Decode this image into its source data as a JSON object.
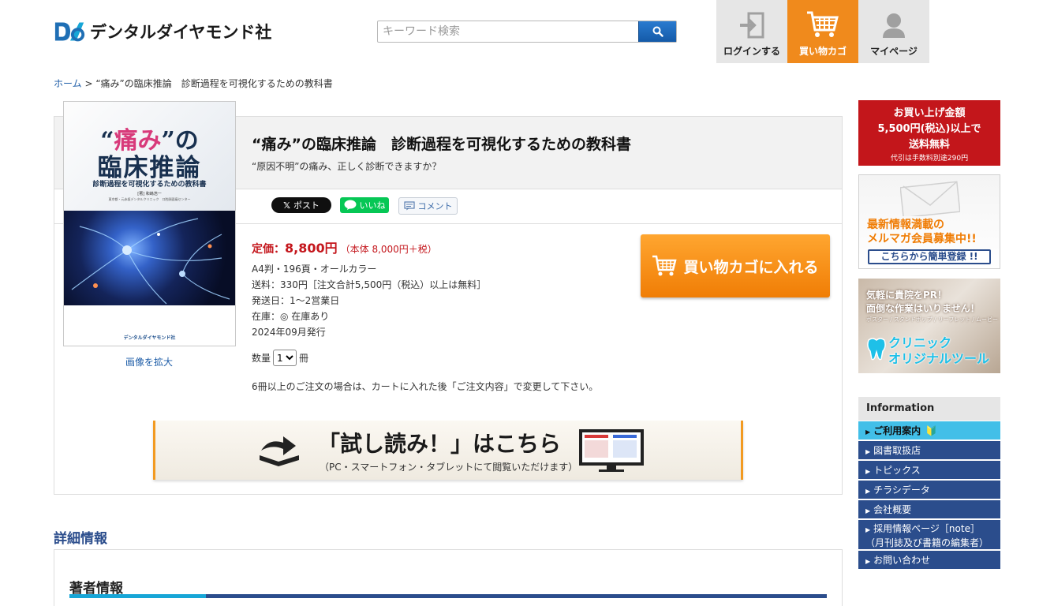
{
  "header": {
    "logo_text": "デンタルダイヤモンド社",
    "search_placeholder": "キーワード検索",
    "nav": [
      {
        "label": "ログインする"
      },
      {
        "label": "買い物カゴ"
      },
      {
        "label": "マイページ"
      }
    ]
  },
  "breadcrumb": {
    "home": "ホーム",
    "sep": " > ",
    "current": "“痛み”の臨床推論　診断過程を可視化するための教科書"
  },
  "product": {
    "title": "“痛み”の臨床推論　診断過程を可視化するための教科書",
    "subtitle": "“原因不明”の痛み、正しく診断できますか？",
    "cover": {
      "title_pink": "痛み",
      "title_line1_open": "“",
      "title_line1_close": "”の",
      "title_line2": "臨床推論",
      "subtitle": "診断過程を可視化するための教科書",
      "author": "[著] 和嶋浩一",
      "institution": "東京都・元赤坂デンタルクリニック　口腔顔面痛センター",
      "publisher": "デンタルダイヤモンド社"
    },
    "enlarge_label": "画像を拡大",
    "social": {
      "x_label": "ポスト",
      "line_label": "いいね",
      "comment_label": "コメント"
    },
    "price_label": "定価：",
    "price": "8,800円",
    "price_tax": "（本体 8,000円＋税）",
    "specs": [
      "A4判・196頁・オールカラー",
      "送料：330円［注文合計5,500円（税込）以上は無料］",
      "発送日：1〜2営業日",
      "在庫：◎ 在庫あり",
      "2024年09月発行"
    ],
    "qty_label": "数量",
    "qty_value": "1",
    "qty_unit": "冊",
    "note": "6冊以上のご注文の場合は、カートに入れた後「ご注文内容」で変更して下さい。",
    "cart_button": "買い物カゴに入れる",
    "trial_main": "「試し読み！」はこちら",
    "trial_sub": "（PC・スマートフォン・タブレットにて閲覧いただけます）"
  },
  "details": {
    "section_title": "詳細情報",
    "author_title": "著者情報"
  },
  "sidebar": {
    "free_shipping": {
      "line1": "お買い上げ金額",
      "line2": "5,500円(税込)以上で",
      "line3": "送料無料",
      "line4": "代引は手数料別途290円"
    },
    "mail": {
      "line1": "最新情報満載の",
      "line2": "メルマガ会員募集中!!",
      "button": "こちらから簡単登録 !!"
    },
    "clinic": {
      "line1": "気軽に貴院をPR！",
      "line2": "面倒な作業はいりません！",
      "line3": "ポスター / スタンドポップ / リーフレット / ムービー",
      "line4": "クリニック",
      "line5": "オリジナルツール"
    },
    "info": {
      "heading": "Information",
      "items": [
        "ご利用案内",
        "図書取扱店",
        "トピックス",
        "チラシデータ",
        "会社概要",
        "採用情報ページ［note］",
        "（月刊誌及び書籍の編集者）",
        "お問い合わせ"
      ]
    }
  },
  "colors": {
    "accent_orange": "#f08a1c",
    "brand_navy": "#2b4d8c",
    "price_red": "#c4161c",
    "link_blue": "#1f5ea8"
  }
}
